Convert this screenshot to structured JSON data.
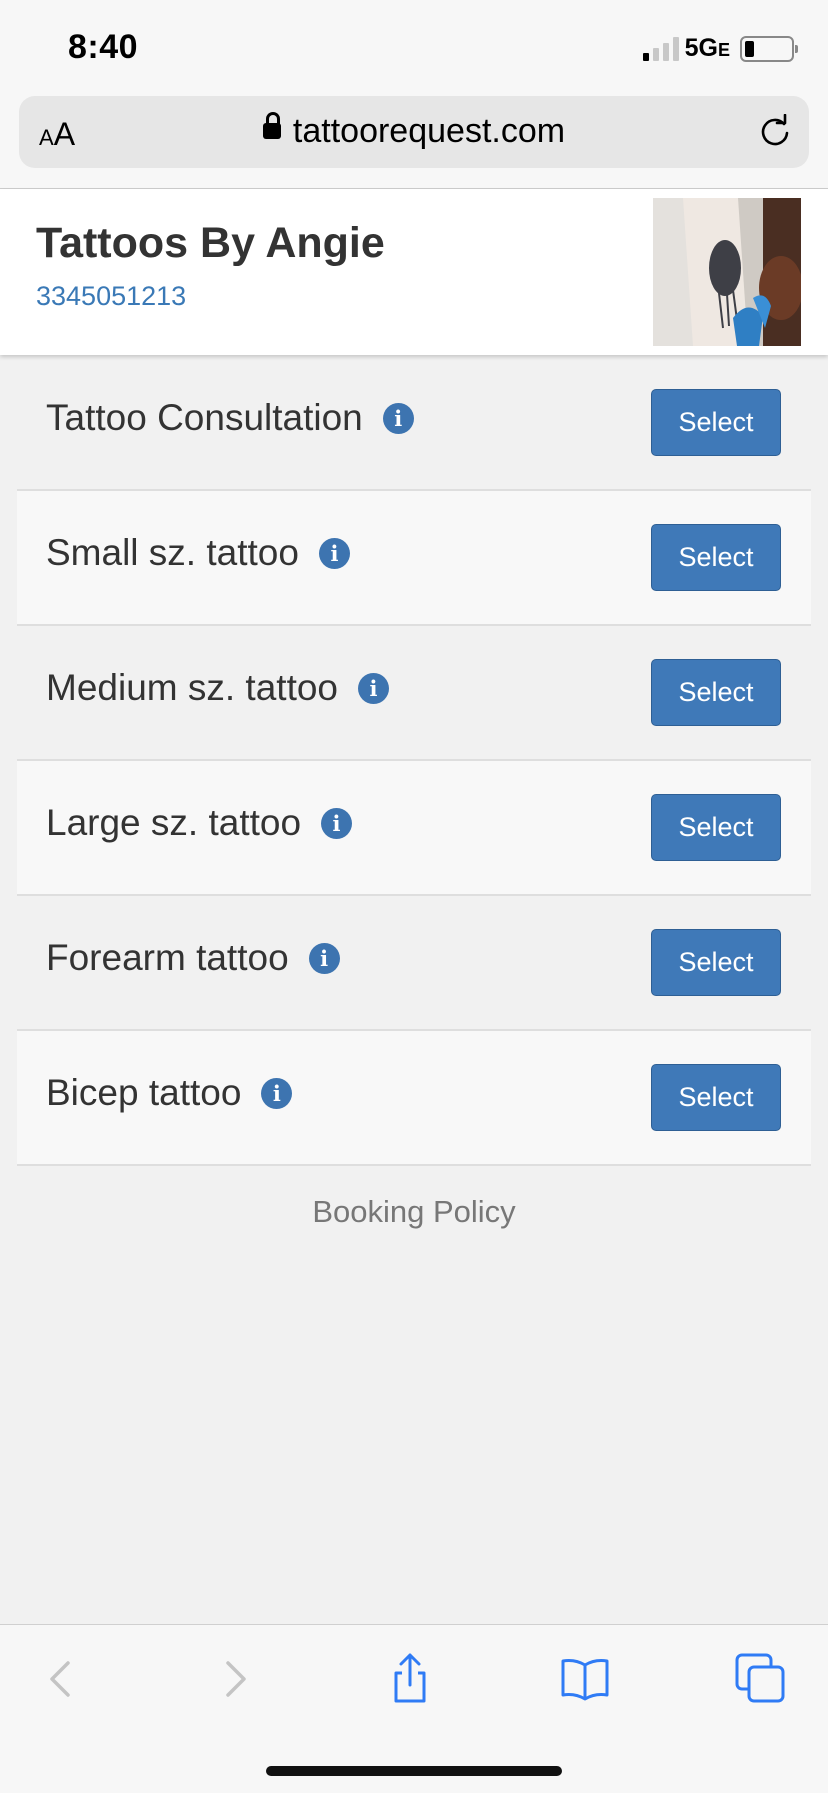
{
  "status_bar": {
    "time": "8:40",
    "network": "5G",
    "network_suffix": "E",
    "signal_bars_active": 1,
    "signal_bars_total": 4,
    "battery_level": 0.2
  },
  "browser": {
    "text_size_label_small": "A",
    "text_size_label_big": "A",
    "url": "tattoorequest.com"
  },
  "business": {
    "name": "Tattoos By Angie",
    "phone": "3345051213"
  },
  "services": [
    {
      "label": "Tattoo Consultation",
      "button": "Select"
    },
    {
      "label": "Small sz. tattoo",
      "button": "Select"
    },
    {
      "label": "Medium sz. tattoo",
      "button": "Select"
    },
    {
      "label": "Large sz. tattoo",
      "button": "Select"
    },
    {
      "label": "Forearm tattoo",
      "button": "Select"
    },
    {
      "label": "Bicep tattoo",
      "button": "Select"
    }
  ],
  "info_glyph": "i",
  "footer": {
    "policy_link": "Booking Policy"
  },
  "colors": {
    "accent": "#3f79b8",
    "link": "#3a79b6",
    "toolbar_icon_active": "#2f7bf5",
    "toolbar_icon_disabled": "#c4c4c4"
  },
  "toolbar_icons": [
    "back-icon",
    "forward-icon",
    "share-icon",
    "bookmarks-icon",
    "tabs-icon"
  ]
}
